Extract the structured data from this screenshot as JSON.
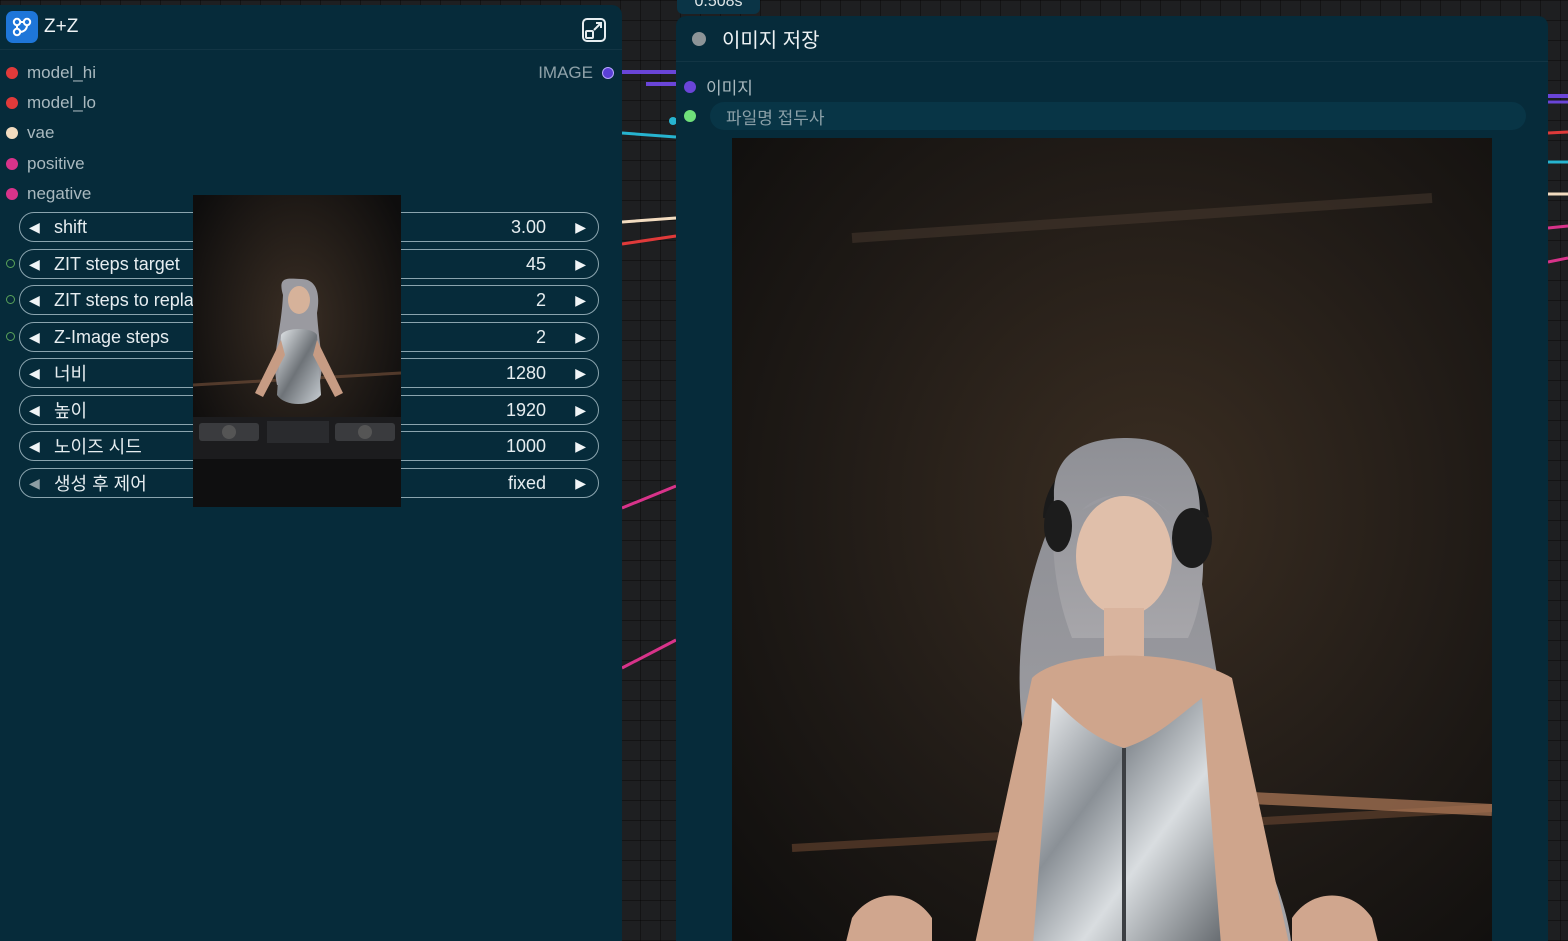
{
  "left_node": {
    "title": "Z+Z",
    "inputs": [
      {
        "label": "model_hi",
        "color": "#e03a3a"
      },
      {
        "label": "model_lo",
        "color": "#e03a3a"
      },
      {
        "label": "vae",
        "color": "#f3dcc0"
      },
      {
        "label": "positive",
        "color": "#d8338a"
      },
      {
        "label": "negative",
        "color": "#d8338a"
      }
    ],
    "output": {
      "label": "IMAGE",
      "color": "#5b3fd6"
    },
    "widgets": [
      {
        "label": "shift",
        "value": "3.00"
      },
      {
        "label": "ZIT steps target",
        "value": "45"
      },
      {
        "label": "ZIT steps to repla",
        "value": "2"
      },
      {
        "label": "Z-Image steps",
        "value": "2"
      },
      {
        "label": "너비",
        "value": "1280"
      },
      {
        "label": "높이",
        "value": "1920"
      },
      {
        "label": "노이즈 시드",
        "value": "1000"
      },
      {
        "label": "생성 후 제어",
        "value": "fixed"
      }
    ]
  },
  "right_node": {
    "timing": "0.508s",
    "title": "이미지 저장",
    "input": {
      "label": "이미지",
      "color": "#6a45d8"
    },
    "filename_prefix": {
      "placeholder": "파일명 접두사",
      "color": "#6fe07a"
    }
  },
  "icons": {
    "subgraph": "subgraph-icon",
    "expand": "expand-icon",
    "arrow_left": "◀",
    "arrow_right": "▶"
  },
  "colors": {
    "node_bg": "#062b3a",
    "canvas_bg": "#1e1f21",
    "accent_blue": "#1e76d9"
  }
}
